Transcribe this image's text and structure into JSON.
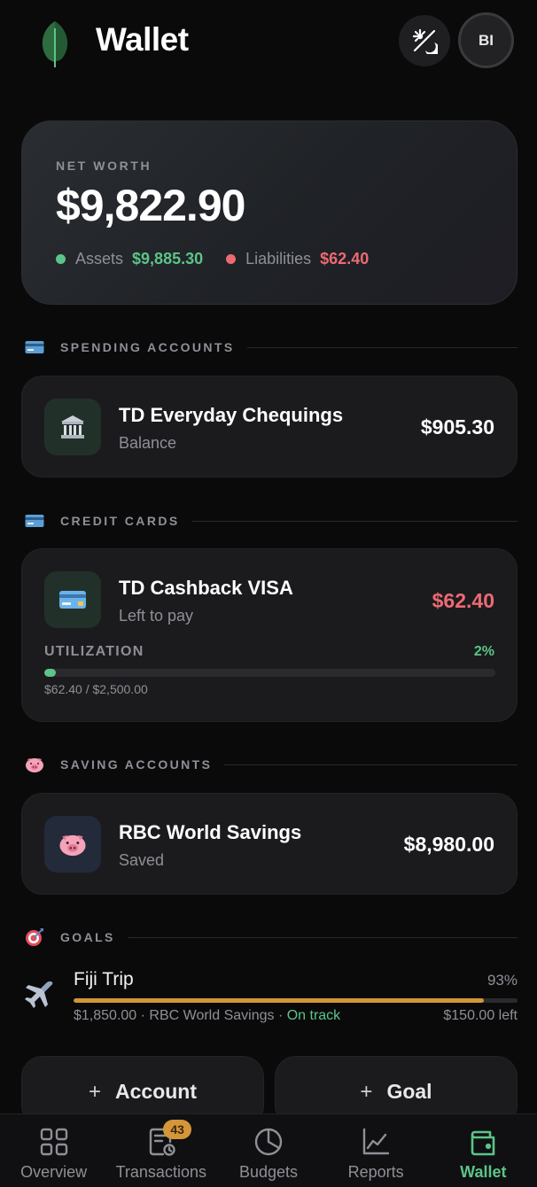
{
  "header": {
    "title": "Wallet",
    "avatar_initials": "BI",
    "logo_icon": "leaf-icon",
    "theme_icon": "theme-toggle-icon"
  },
  "net_worth": {
    "label": "NET WORTH",
    "value": "$9,822.90",
    "assets_label": "Assets",
    "assets_value": "$9,885.30",
    "liabilities_label": "Liabilities",
    "liabilities_value": "$62.40",
    "assets_color": "#5cc488",
    "liabilities_color": "#ec6a74"
  },
  "spending": {
    "section_label": "SPENDING ACCOUNTS",
    "account_name": "TD Everyday Chequings",
    "account_sub": "Balance",
    "account_amount": "$905.30",
    "icon": "bank-icon"
  },
  "credit": {
    "section_label": "CREDIT CARDS",
    "account_name": "TD Cashback VISA",
    "account_sub": "Left to pay",
    "account_amount": "$62.40",
    "utilization_label": "UTILIZATION",
    "utilization_pct": "2%",
    "utilization_value": 0.025,
    "utilization_detail": "$62.40 / $2,500.00",
    "icon": "credit-card-icon"
  },
  "saving": {
    "section_label": "SAVING ACCOUNTS",
    "account_name": "RBC World Savings",
    "account_sub": "Saved",
    "account_amount": "$8,980.00",
    "icon": "piggy-bank-icon"
  },
  "goals": {
    "section_label": "GOALS",
    "items": [
      {
        "name": "Fiji Trip",
        "pct": "93%",
        "progress": 0.925,
        "saved": "$1,850.00",
        "account": "RBC World Savings",
        "status": "On track",
        "left": "$150.00 left",
        "icon": "airplane-icon"
      }
    ]
  },
  "actions": {
    "add_account": "Account",
    "add_goal": "Goal"
  },
  "nav": {
    "items": [
      {
        "label": "Overview",
        "icon": "grid-icon"
      },
      {
        "label": "Transactions",
        "icon": "receipt-icon",
        "badge": "43"
      },
      {
        "label": "Budgets",
        "icon": "pie-chart-icon"
      },
      {
        "label": "Reports",
        "icon": "line-chart-icon"
      },
      {
        "label": "Wallet",
        "icon": "wallet-icon",
        "active": true
      }
    ]
  },
  "colors": {
    "accent": "#5cc488",
    "danger": "#ec6a74",
    "goal": "#d49638",
    "background": "#0a0a0b",
    "card": "#1b1b1e"
  }
}
